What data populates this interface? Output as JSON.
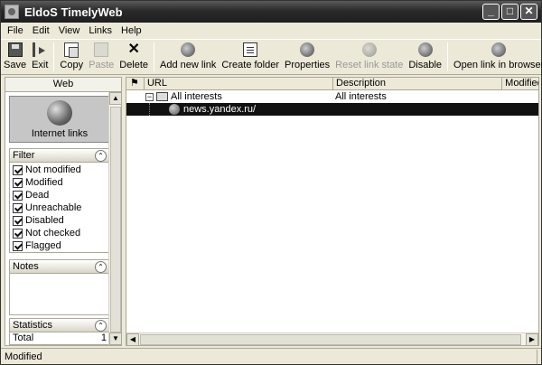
{
  "window": {
    "title": "EldoS TimelyWeb"
  },
  "menu": [
    "File",
    "Edit",
    "View",
    "Links",
    "Help"
  ],
  "toolbar": {
    "save": "Save",
    "exit": "Exit",
    "copy": "Copy",
    "paste": "Paste",
    "delete": "Delete",
    "add_new_link": "Add new link",
    "create_folder": "Create folder",
    "properties": "Properties",
    "reset_link_state": "Reset link state",
    "disable": "Disable",
    "open_link_in_browser": "Open link in browser"
  },
  "left_panel": {
    "header": "Web",
    "internet_links": "Internet links",
    "filter": {
      "title": "Filter",
      "items": [
        {
          "label": "Not modified",
          "checked": true
        },
        {
          "label": "Modified",
          "checked": true
        },
        {
          "label": "Dead",
          "checked": true
        },
        {
          "label": "Unreachable",
          "checked": true
        },
        {
          "label": "Disabled",
          "checked": true
        },
        {
          "label": "Not checked",
          "checked": true
        },
        {
          "label": "Flagged",
          "checked": true
        }
      ]
    },
    "notes": {
      "title": "Notes"
    },
    "statistics": {
      "title": "Statistics",
      "rows": [
        {
          "label": "Total",
          "value": "1"
        }
      ]
    }
  },
  "grid": {
    "columns": {
      "url": "URL",
      "description": "Description",
      "modified": "Modified"
    },
    "rows": [
      {
        "url": "All interests",
        "description": "All interests",
        "type": "folder"
      },
      {
        "url": "news.yandex.ru/",
        "description": "",
        "type": "link",
        "selected": true
      }
    ]
  },
  "status": {
    "text": "Modified"
  }
}
